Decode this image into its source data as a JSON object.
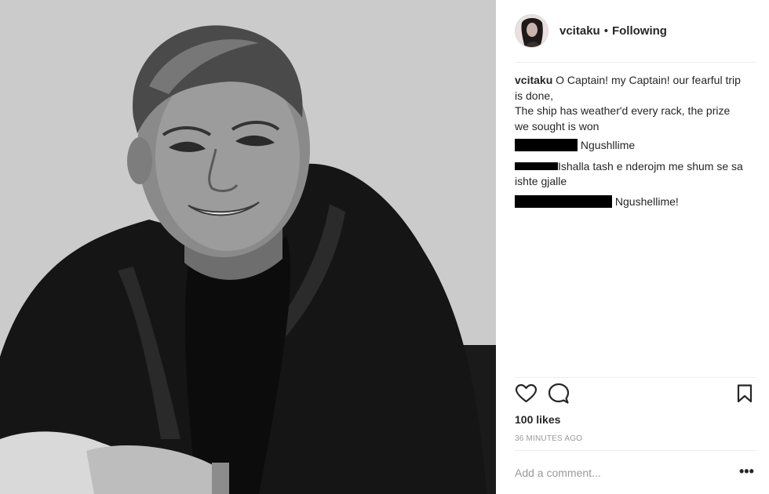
{
  "post": {
    "username": "vcitaku",
    "separator": "•",
    "follow_status": "Following",
    "caption": {
      "user": "vcitaku",
      "lines": [
        "O Captain! my Captain! our fearful trip",
        "is done,",
        "The ship has weather'd every rack, the prize",
        "we sought is won"
      ]
    },
    "comments": [
      {
        "user_redacted": true,
        "text": "Ngushllime"
      },
      {
        "user_visible_fragment": "",
        "text_line1": "Ishalla tash e nderojm me shum se sa",
        "text_line2": "ishte gjalle"
      },
      {
        "user_redacted": true,
        "text": "Ngushellime!"
      }
    ],
    "likes": "100 likes",
    "time": "36 MINUTES AGO",
    "add_comment_placeholder": "Add a comment...",
    "more_icon": "•••"
  },
  "icons": {
    "like": "heart-icon",
    "comment": "speech-bubble-icon",
    "save": "bookmark-icon",
    "more": "ellipsis-icon"
  },
  "colors": {
    "text": "#262626",
    "muted": "#999999",
    "divider": "#efefef"
  }
}
